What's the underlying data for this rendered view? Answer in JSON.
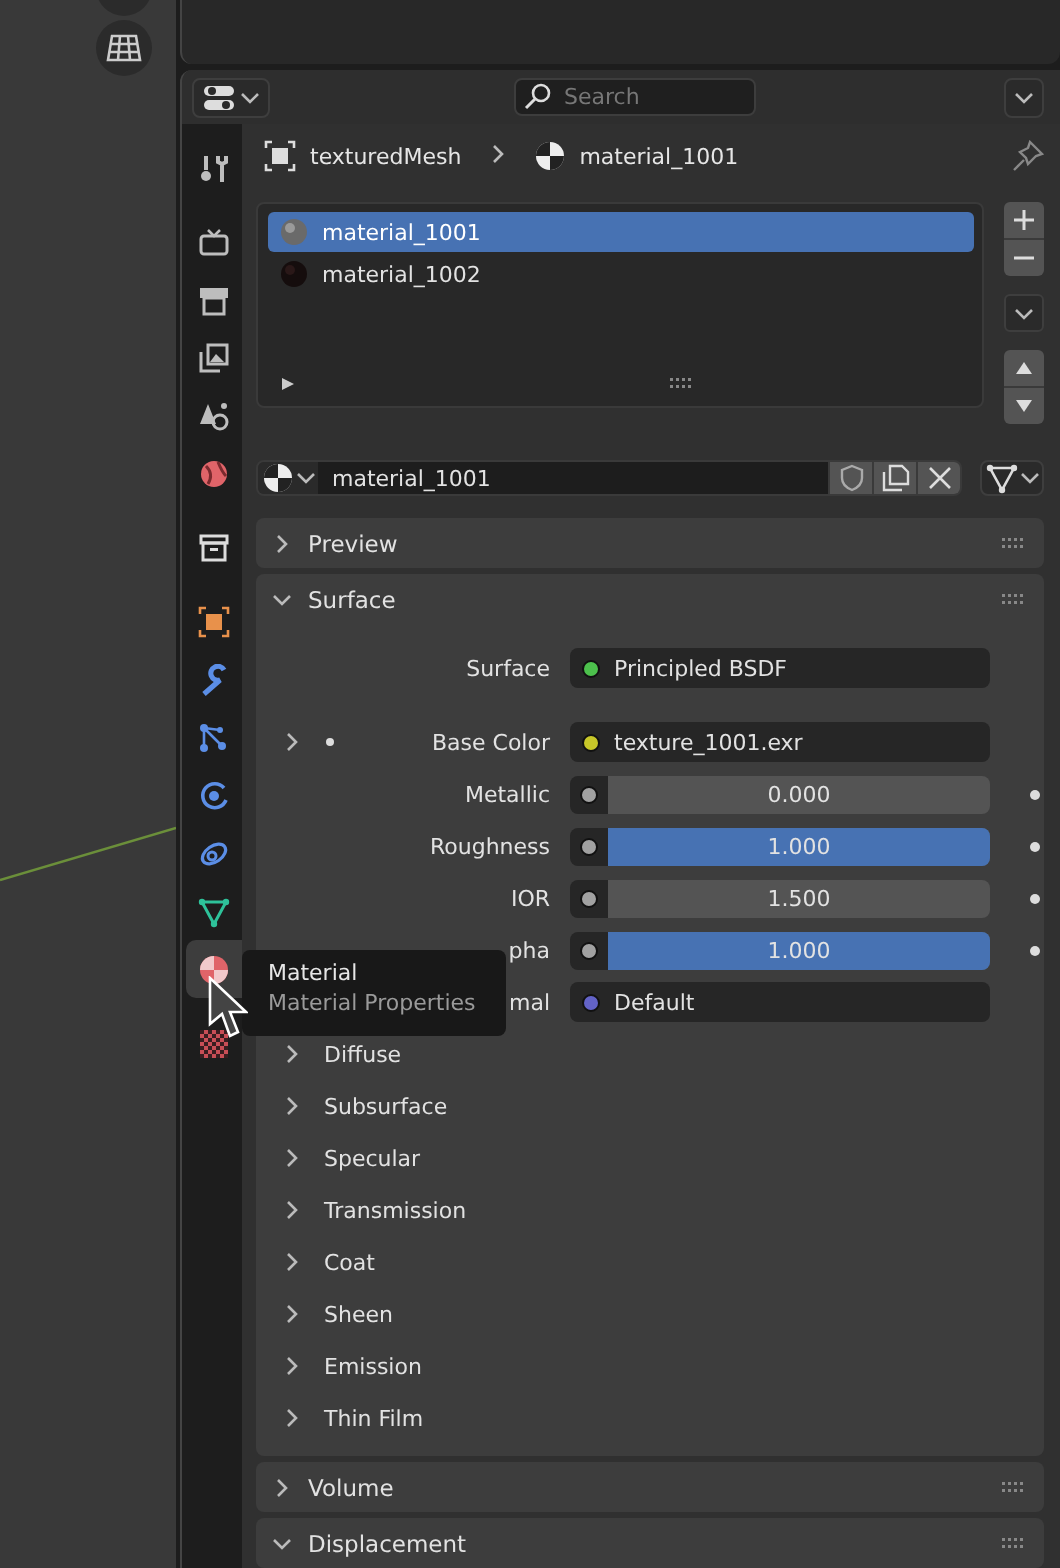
{
  "properties": {
    "search": {
      "placeholder": "Search"
    },
    "tab_groups": [
      {
        "tabs": [
          {
            "kind": "tool",
            "selected": false
          }
        ]
      },
      {
        "tabs": [
          {
            "kind": "render",
            "selected": false
          },
          {
            "kind": "output",
            "selected": false
          },
          {
            "kind": "view-layer",
            "selected": false
          },
          {
            "kind": "scene",
            "selected": false
          },
          {
            "kind": "world",
            "selected": false
          }
        ]
      },
      {
        "tabs": [
          {
            "kind": "collection",
            "selected": false
          }
        ]
      },
      {
        "tabs": [
          {
            "kind": "object",
            "selected": false
          },
          {
            "kind": "modifier",
            "selected": false
          },
          {
            "kind": "particles",
            "selected": false
          },
          {
            "kind": "physics",
            "selected": false
          },
          {
            "kind": "constraints",
            "selected": false
          },
          {
            "kind": "data",
            "selected": false
          },
          {
            "kind": "material",
            "selected": true
          }
        ]
      },
      {
        "tabs": [
          {
            "kind": "texture",
            "selected": false
          }
        ]
      }
    ],
    "breadcrumb": {
      "object": "texturedMesh",
      "material": "material_1001"
    },
    "material_slots": [
      {
        "name": "material_1001",
        "selected": true
      },
      {
        "name": "material_1002",
        "selected": false
      }
    ],
    "material_field": {
      "value": "material_1001"
    },
    "panels": [
      {
        "title": "Preview",
        "expanded": false
      },
      {
        "title": "Surface",
        "expanded": true,
        "rows": [
          {
            "kind": "link",
            "label": "Surface",
            "value": "Principled BSDF",
            "color": "#4cc04c",
            "expandable": false
          },
          {
            "kind": "link",
            "label": "Base Color",
            "value": "texture_1001.exr",
            "color": "#c7c729",
            "expandable": true
          },
          {
            "kind": "slider",
            "label": "Metallic",
            "value": "0.000",
            "level": 0
          },
          {
            "kind": "slider",
            "label": "Roughness",
            "value": "1.000",
            "level": 1
          },
          {
            "kind": "number",
            "label": "IOR",
            "value": "1.500"
          },
          {
            "kind": "slider",
            "label": "pha",
            "value": "1.000",
            "level": 1
          },
          {
            "kind": "link",
            "label": "mal",
            "value": "Default",
            "color": "#6363c7",
            "expandable": false
          }
        ],
        "subpanels": [
          {
            "title": "Diffuse",
            "expanded": false
          },
          {
            "title": "Subsurface",
            "expanded": false
          },
          {
            "title": "Specular",
            "expanded": false
          },
          {
            "title": "Transmission",
            "expanded": false
          },
          {
            "title": "Coat",
            "expanded": false
          },
          {
            "title": "Sheen",
            "expanded": false
          },
          {
            "title": "Emission",
            "expanded": false
          },
          {
            "title": "Thin Film",
            "expanded": false
          }
        ]
      },
      {
        "title": "Volume",
        "expanded": false
      },
      {
        "title": "Displacement",
        "expanded": true
      }
    ]
  },
  "tooltip": {
    "title": "Material",
    "description": "Material Properties"
  }
}
